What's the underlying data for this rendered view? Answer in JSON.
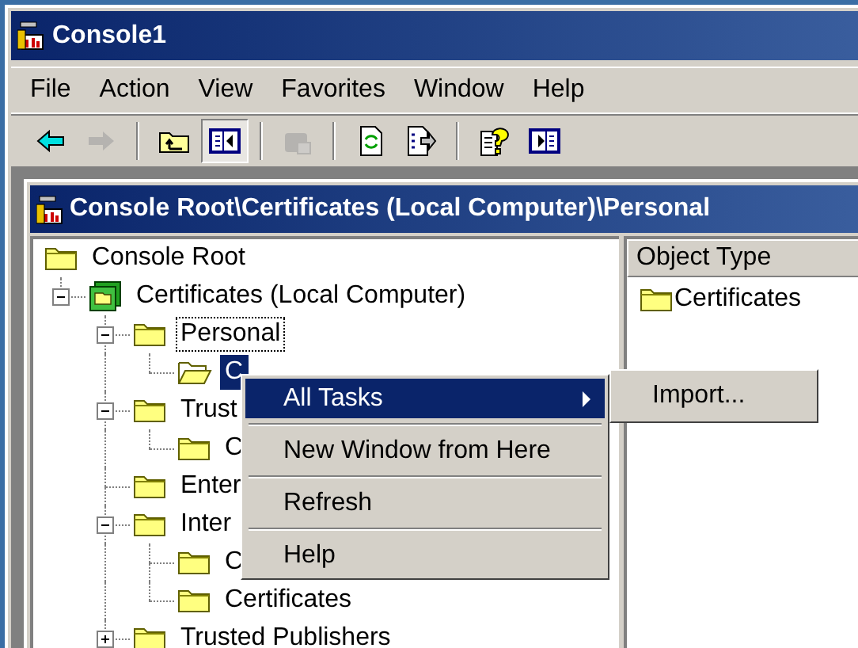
{
  "window": {
    "title": "Console1"
  },
  "menu_bar": [
    {
      "label": "File"
    },
    {
      "label": "Action"
    },
    {
      "label": "View"
    },
    {
      "label": "Favorites"
    },
    {
      "label": "Window"
    },
    {
      "label": "Help"
    }
  ],
  "toolbar": [
    {
      "disabled": false,
      "pressed": false
    },
    {
      "disabled": true,
      "pressed": false
    },
    {
      "disabled": false,
      "pressed": false
    },
    {
      "disabled": false,
      "pressed": true
    },
    {
      "disabled": true,
      "pressed": false
    },
    {
      "disabled": false,
      "pressed": false
    },
    {
      "disabled": false,
      "pressed": false
    },
    {
      "disabled": false,
      "pressed": false
    },
    {
      "disabled": false,
      "pressed": false
    }
  ],
  "child_window": {
    "title": "Console Root\\Certificates (Local Computer)\\Personal"
  },
  "tree": [
    {
      "label": "Console Root",
      "kind": "folder",
      "selected": false,
      "focused": false,
      "children": [
        {
          "label": "Certificates (Local Computer)",
          "kind": "store",
          "expanded": true,
          "selected": false,
          "focused": false,
          "children": [
            {
              "label": "Personal",
              "kind": "folder",
              "expanded": true,
              "selected": false,
              "focused": true,
              "children": [
                {
                  "label": "C",
                  "kind": "open-folder",
                  "selected": true,
                  "focused": false
                }
              ]
            },
            {
              "label": "Trust",
              "kind": "folder",
              "expanded": true,
              "selected": false,
              "focused": false,
              "children": [
                {
                  "label": "C",
                  "kind": "folder",
                  "selected": false,
                  "focused": false
                }
              ]
            },
            {
              "label": "Enter",
              "kind": "folder",
              "selected": false,
              "focused": false
            },
            {
              "label": "Inter",
              "kind": "folder",
              "expanded": true,
              "selected": false,
              "focused": false,
              "children": [
                {
                  "label": "C",
                  "kind": "folder",
                  "selected": false,
                  "focused": false
                },
                {
                  "label": "Certificates",
                  "kind": "folder",
                  "selected": false,
                  "focused": false
                }
              ]
            },
            {
              "label": "Trusted Publishers",
              "kind": "folder",
              "expanded": false,
              "selected": false,
              "focused": false
            }
          ]
        }
      ]
    }
  ],
  "list": {
    "columns": [
      "Object Type"
    ],
    "rows": [
      "Certificates"
    ]
  },
  "context_menu": [
    {
      "kind": "item",
      "label": "All Tasks",
      "submenu": true,
      "selected": true
    },
    {
      "kind": "separator"
    },
    {
      "kind": "item",
      "label": "New Window from Here",
      "submenu": false,
      "selected": false
    },
    {
      "kind": "separator"
    },
    {
      "kind": "item",
      "label": "Refresh",
      "submenu": false,
      "selected": false
    },
    {
      "kind": "separator"
    },
    {
      "kind": "item",
      "label": "Help",
      "submenu": false,
      "selected": false
    }
  ],
  "submenu": [
    {
      "label": "Import...",
      "selected": false
    }
  ]
}
